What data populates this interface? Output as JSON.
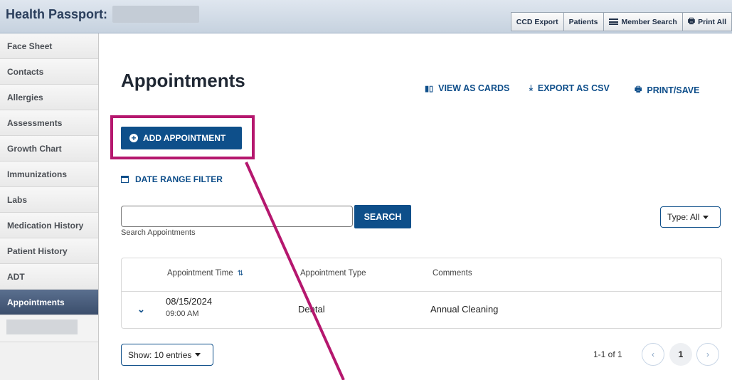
{
  "header": {
    "brand": "Health Passport:",
    "buttons": {
      "ccd_export": "CCD Export",
      "patients": "Patients",
      "member_search": "Member Search",
      "print_all": "Print All"
    }
  },
  "sidebar": {
    "items": [
      {
        "label": "Face Sheet"
      },
      {
        "label": "Contacts"
      },
      {
        "label": "Allergies"
      },
      {
        "label": "Assessments"
      },
      {
        "label": "Growth Chart"
      },
      {
        "label": "Immunizations"
      },
      {
        "label": "Labs"
      },
      {
        "label": "Medication History"
      },
      {
        "label": "Patient History"
      },
      {
        "label": "ADT"
      },
      {
        "label": "Appointments"
      }
    ],
    "active": "Appointments"
  },
  "main": {
    "title": "Appointments",
    "actions": {
      "view_as_cards": "VIEW AS CARDS",
      "export_as_csv": "EXPORT AS CSV",
      "print_save": "PRINT/SAVE"
    },
    "add_appointment": "ADD APPOINTMENT",
    "date_range_filter": "DATE RANGE FILTER",
    "search": {
      "value": "",
      "placeholder": "",
      "button": "SEARCH",
      "helper": "Search Appointments"
    },
    "type_filter": "Type: All",
    "table": {
      "headers": [
        "Appointment Time",
        "Appointment Type",
        "Comments"
      ],
      "rows": [
        {
          "date": "08/15/2024",
          "time": "09:00 AM",
          "type": "Dental",
          "comments": "Annual Cleaning"
        }
      ]
    },
    "show_entries": "Show: 10 entries",
    "pagination": {
      "summary": "1-1 of 1",
      "current_page": "1",
      "prev": "‹",
      "next": "›"
    }
  },
  "colors": {
    "primary": "#0e4f8a",
    "highlight": "#b5176e",
    "sidebar_active": "#3b4e6c"
  }
}
